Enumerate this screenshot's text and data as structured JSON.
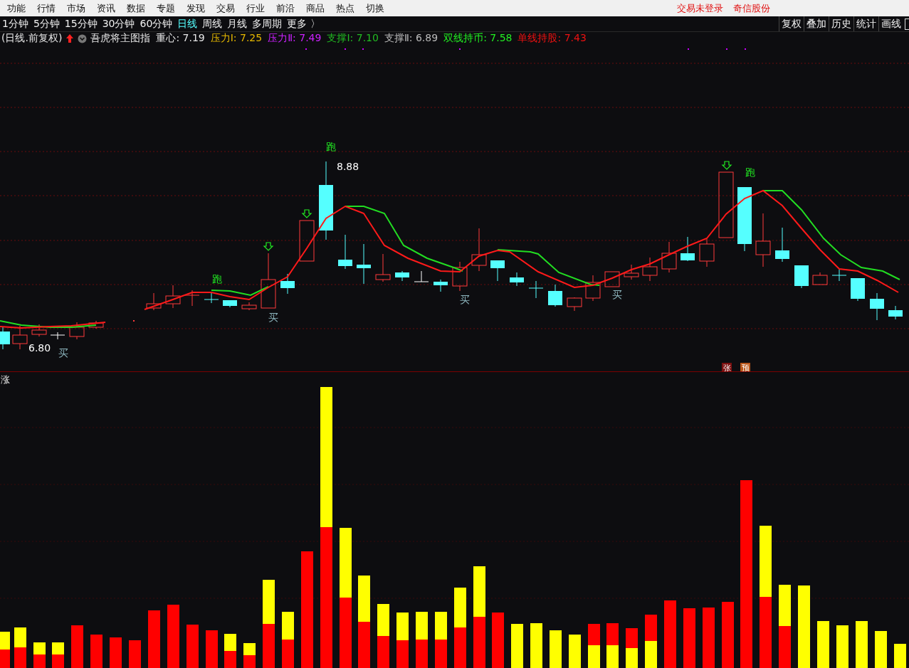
{
  "menu": [
    "功能",
    "行情",
    "市场",
    "资讯",
    "数据",
    "专题",
    "发现",
    "交易",
    "行业",
    "前沿",
    "商品",
    "热点",
    "切换"
  ],
  "status": [
    "交易未登录",
    "奇信股份"
  ],
  "periods": [
    {
      "label": "1分钟",
      "selected": false
    },
    {
      "label": "5分钟",
      "selected": false
    },
    {
      "label": "15分钟",
      "selected": false
    },
    {
      "label": "30分钟",
      "selected": false
    },
    {
      "label": "60分钟",
      "selected": false
    },
    {
      "label": "日线",
      "selected": true
    },
    {
      "label": "周线",
      "selected": false
    },
    {
      "label": "月线",
      "selected": false
    },
    {
      "label": "多周期",
      "selected": false
    },
    {
      "label": "更多 〉",
      "selected": false
    }
  ],
  "tools": [
    "复权",
    "叠加",
    "历史",
    "统计",
    "画线"
  ],
  "chart_info": {
    "mode": "(日线.前复权)",
    "indicator": "吾虎将主图指",
    "values": [
      {
        "text": "重心: 7.19",
        "color": "#e6e6e6"
      },
      {
        "text": "压力Ⅰ: 7.25",
        "color": "#e6b800"
      },
      {
        "text": "压力Ⅱ: 7.49",
        "color": "#cc22ff"
      },
      {
        "text": "支撑Ⅰ: 7.10",
        "color": "#22bb22"
      },
      {
        "text": "支撑Ⅱ: 6.89",
        "color": "#bbbbbb"
      },
      {
        "text": "双线持币: 7.58",
        "color": "#22ee22"
      },
      {
        "text": "单线持股: 7.43",
        "color": "#ee1111"
      }
    ]
  },
  "chart_labels": [
    {
      "kind": "run",
      "text": "跑"
    },
    {
      "kind": "price",
      "text": "8.88"
    },
    {
      "kind": "run",
      "text": "跑"
    },
    {
      "kind": "run",
      "text": "跑"
    },
    {
      "kind": "price",
      "text": "6.80"
    },
    {
      "kind": "buy",
      "text": "买"
    },
    {
      "kind": "buy",
      "text": "买"
    },
    {
      "kind": "buy",
      "text": "买"
    },
    {
      "kind": "buy",
      "text": "买"
    }
  ],
  "badges": [
    {
      "text": "张",
      "color": "#7a1010"
    },
    {
      "text": "预",
      "color": "#b8561a"
    }
  ],
  "volume_label": "涨"
}
